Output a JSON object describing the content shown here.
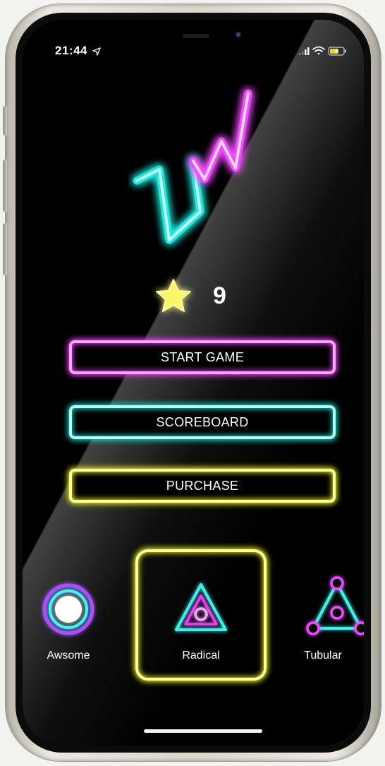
{
  "status_bar": {
    "time": "21:44",
    "icons": [
      "location-arrow-icon",
      "cellular-signal-icon",
      "wifi-icon",
      "battery-charging-icon"
    ]
  },
  "logo": {
    "icon": "neon-zigzag-logo",
    "colors": [
      "#19d4c8",
      "#e23ff2"
    ]
  },
  "stars": {
    "icon": "star-icon",
    "count": "9",
    "color": "#f7f23a"
  },
  "menu": {
    "start_label": "START GAME",
    "scoreboard_label": "SCOREBOARD",
    "purchase_label": "PURCHASE"
  },
  "skins": {
    "selected": "Radical",
    "items": [
      {
        "label": "Awsome",
        "icon": "neon-circle-icon"
      },
      {
        "label": "Radical",
        "icon": "neon-triangle-circle-icon"
      },
      {
        "label": "Tubular",
        "icon": "neon-triangle-nodes-icon"
      }
    ]
  },
  "colors": {
    "pink": "#e23ff2",
    "cyan": "#19d4c8",
    "yellow": "#e4ea1c"
  }
}
